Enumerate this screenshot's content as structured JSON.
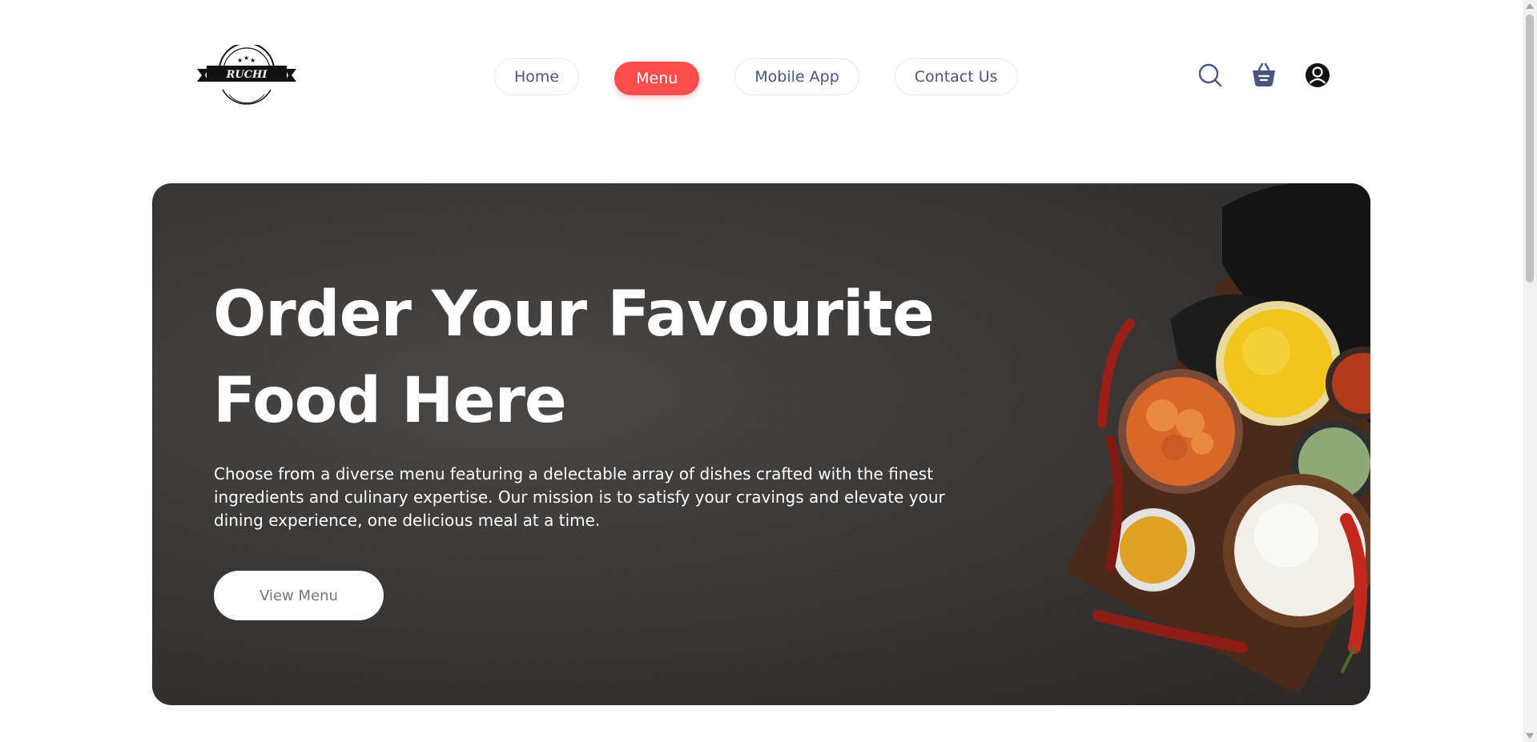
{
  "navbar": {
    "logo_text": "RUCHI",
    "menu": [
      {
        "label": "Home",
        "active": false
      },
      {
        "label": "Menu",
        "active": true
      },
      {
        "label": "Mobile App",
        "active": false
      },
      {
        "label": "Contact Us",
        "active": false
      }
    ],
    "icons": [
      "search-icon",
      "basket-icon",
      "profile-icon"
    ]
  },
  "hero": {
    "title_line1": "Order Your Favourite",
    "title_line2": "Food Here",
    "description": "Choose from a diverse menu featuring a delectable array of dishes crafted with the finest ingredients and culinary expertise. Our mission is to satisfy your cravings and elevate your dining experience, one delicious meal at a time.",
    "button_label": "View Menu"
  },
  "colors": {
    "accent": "#ff4c4c",
    "nav_text": "#49557e",
    "hero_bg": "#3a3836",
    "basket_icon": "#49557e"
  }
}
